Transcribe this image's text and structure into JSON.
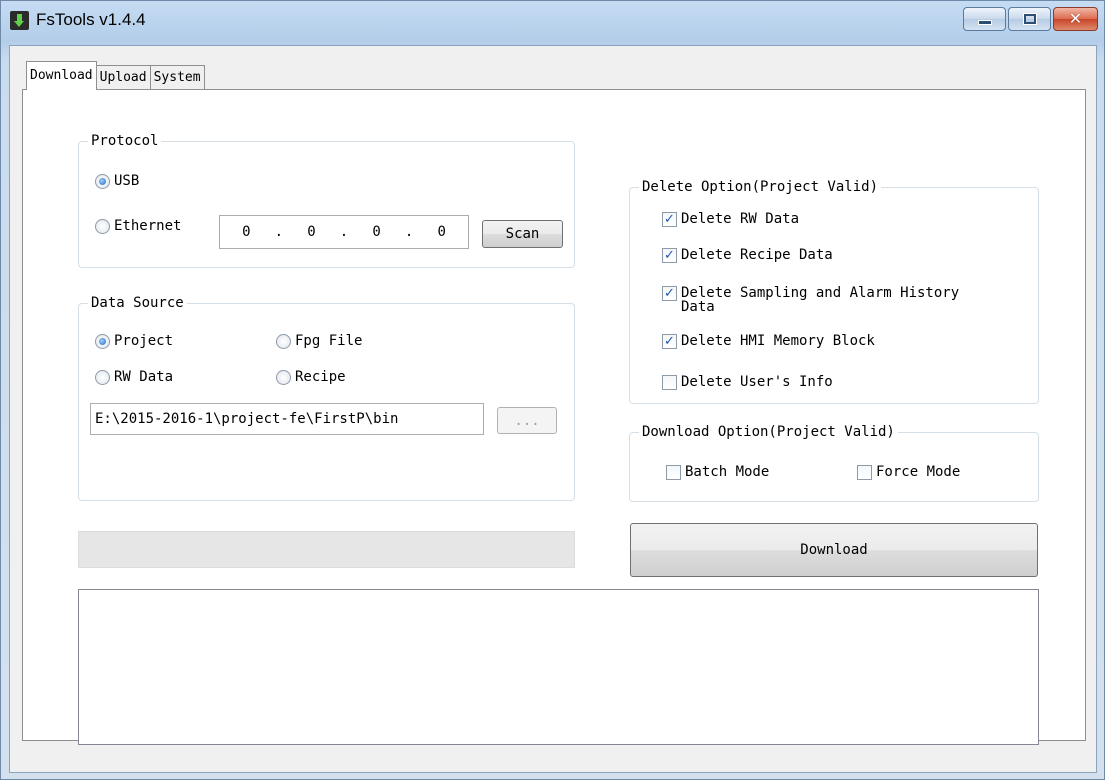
{
  "window": {
    "title": "FsTools v1.4.4"
  },
  "tabs": [
    {
      "label": "Download",
      "active": true
    },
    {
      "label": "Upload",
      "active": false
    },
    {
      "label": "System",
      "active": false
    }
  ],
  "protocol": {
    "legend": "Protocol",
    "usb_label": "USB",
    "ethernet_label": "Ethernet",
    "selected": "USB",
    "ip": [
      "0",
      "0",
      "0",
      "0"
    ],
    "ip_sep": ".",
    "scan_label": "Scan"
  },
  "data_source": {
    "legend": "Data Source",
    "options": [
      {
        "label": "Project",
        "checked": true
      },
      {
        "label": "Fpg File",
        "checked": false
      },
      {
        "label": "RW Data",
        "checked": false
      },
      {
        "label": "Recipe",
        "checked": false
      }
    ],
    "path": "E:\\2015-2016-1\\project-fe\\FirstP\\bin",
    "browse_label": "..."
  },
  "delete_option": {
    "legend": "Delete Option(Project Valid)",
    "items": [
      {
        "label": "Delete RW Data",
        "checked": true
      },
      {
        "label": "Delete Recipe Data",
        "checked": true
      },
      {
        "label": "Delete Sampling and Alarm History",
        "label2": "Data",
        "checked": true
      },
      {
        "label": "Delete HMI Memory Block",
        "checked": true
      },
      {
        "label": "Delete User's Info",
        "checked": false
      }
    ]
  },
  "download_option": {
    "legend": "Download Option(Project Valid)",
    "batch_label": "Batch Mode",
    "batch_checked": false,
    "force_label": "Force Mode",
    "force_checked": false
  },
  "download_button": "Download",
  "progress": 0,
  "log_text": "",
  "colors": {
    "titlebar": "#c5dcf3",
    "panel": "#ffffff",
    "client": "#f0f0f0",
    "check_mark": "#2457a8",
    "radio_dot": "#1e62b8"
  }
}
